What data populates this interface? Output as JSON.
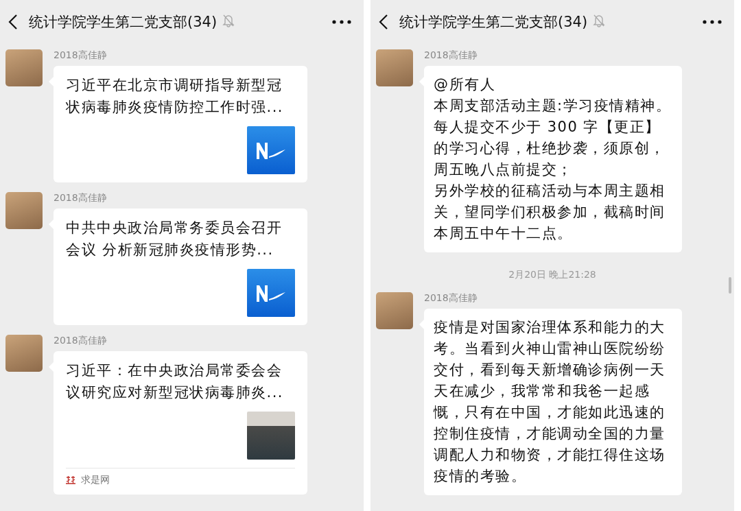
{
  "panels": [
    {
      "header": {
        "title": "统计学院学生第二党支部(34)",
        "muted": true
      },
      "messages": [
        {
          "kind": "card",
          "sender": "2018高佳静",
          "title": "习近平在北京市调研指导新型冠状病毒肺炎疫情防控工作时强...",
          "thumbnail": {
            "kind": "logo"
          }
        },
        {
          "kind": "card",
          "sender": "2018高佳静",
          "title": "中共中央政治局常务委员会召开会议 分析新冠肺炎疫情形势...",
          "thumbnail": {
            "kind": "logo"
          }
        },
        {
          "kind": "card",
          "sender": "2018高佳静",
          "title": "习近平：在中央政治局常委会会议研究应对新型冠状病毒肺炎...",
          "thumbnail": {
            "kind": "photo"
          },
          "source": "求是网"
        }
      ]
    },
    {
      "header": {
        "title": "统计学院学生第二党支部(34)",
        "muted": true
      },
      "scrollbar": true,
      "messages": [
        {
          "kind": "text",
          "sender": "2018高佳静",
          "paragraphs": [
            "@所有人",
            "本周支部活动主题:学习疫情精神。每人提交不少于 300 字【更正】的学习心得，杜绝抄袭，须原创，周五晚八点前提交；",
            "另外学校的征稿活动与本周主题相关，望同学们积极参加，截稿时间本周五中午十二点。"
          ]
        },
        {
          "kind": "time",
          "text": "2月20日 晚上21:28"
        },
        {
          "kind": "text",
          "sender": "2018高佳静",
          "paragraphs": [
            "疫情是对国家治理体系和能力的大考。当看到火神山雷神山医院纷纷交付，看到每天新增确诊病例一天天在减少，我常常和我爸一起感慨，只有在中国，才能如此迅速的控制住疫情，才能调动全国的力量调配人力和物资，才能扛得住这场疫情的考验。"
          ]
        }
      ]
    }
  ]
}
